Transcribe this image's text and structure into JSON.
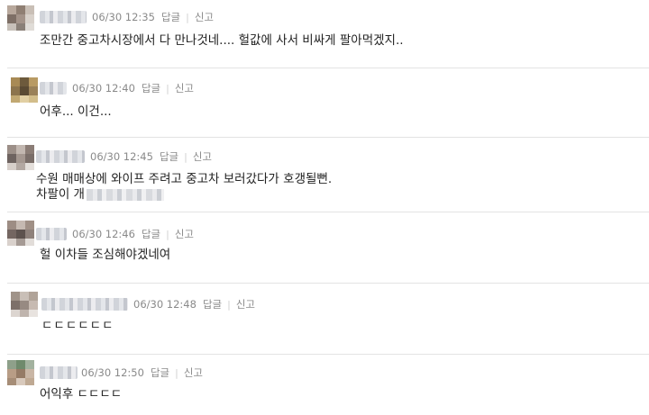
{
  "comments": [
    {
      "date": "06/30 12:35",
      "reply": "답글",
      "report": "신고",
      "text": "조만간 중고차시장에서 다 만나것네.... 헐값에 사서 비싸게 팔아먹겠지..",
      "text2": ""
    },
    {
      "date": "06/30 12:40",
      "reply": "답글",
      "report": "신고",
      "text": "어후... 이건...",
      "text2": ""
    },
    {
      "date": "06/30 12:45",
      "reply": "답글",
      "report": "신고",
      "text": "수원 매매상에 와이프 주려고 중고차 보러갔다가 호갱될뻔.",
      "text2": "차팔이 개"
    },
    {
      "date": "06/30 12:46",
      "reply": "답글",
      "report": "신고",
      "text": "헐 이차들 조심해야겠네여",
      "text2": ""
    },
    {
      "date": "06/30 12:48",
      "reply": "답글",
      "report": "신고",
      "text": "ㄷㄷㄷㄷㄷㄷ",
      "text2": ""
    },
    {
      "date": "06/30 12:50",
      "reply": "답글",
      "report": "신고",
      "text": "어익후 ㄷㄷㄷㄷ",
      "text2": ""
    }
  ]
}
